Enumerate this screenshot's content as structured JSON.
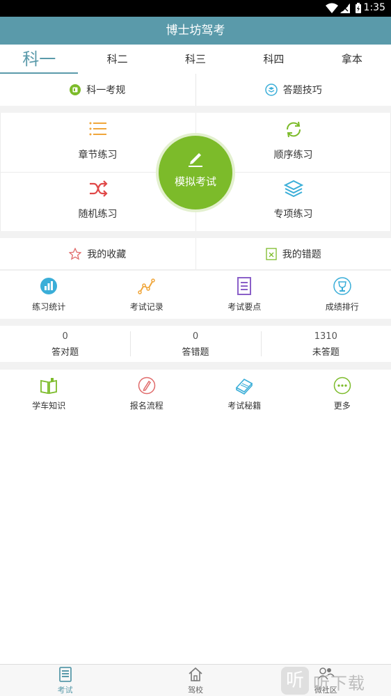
{
  "status_bar": {
    "time": "1:35"
  },
  "app": {
    "title": "博士坊驾考"
  },
  "subjects": {
    "tabs": [
      "科一",
      "科二",
      "科三",
      "科四",
      "拿本"
    ],
    "active_index": 0
  },
  "top_links": {
    "rules": "科一考规",
    "tips": "答题技巧"
  },
  "practice": {
    "chapter": "章节练习",
    "sequential": "顺序练习",
    "random": "随机练习",
    "special": "专项练习",
    "mock_exam": "模拟考试"
  },
  "favorites": {
    "collection": "我的收藏",
    "mistakes": "我的错题"
  },
  "tools": [
    "练习统计",
    "考试记录",
    "考试要点",
    "成绩排行"
  ],
  "stats": [
    {
      "value": "0",
      "label": "答对题"
    },
    {
      "value": "0",
      "label": "答错题"
    },
    {
      "value": "1310",
      "label": "未答题"
    }
  ],
  "more": [
    "学车知识",
    "报名流程",
    "考试秘籍",
    "更多"
  ],
  "bottom_nav": {
    "items": [
      "考试",
      "驾校",
      "微社区"
    ],
    "active_index": 0
  },
  "watermark": {
    "text": "听下载",
    "glyph": "听"
  },
  "colors": {
    "primary": "#5a9aaa",
    "accent_green": "#7cbb2a"
  }
}
